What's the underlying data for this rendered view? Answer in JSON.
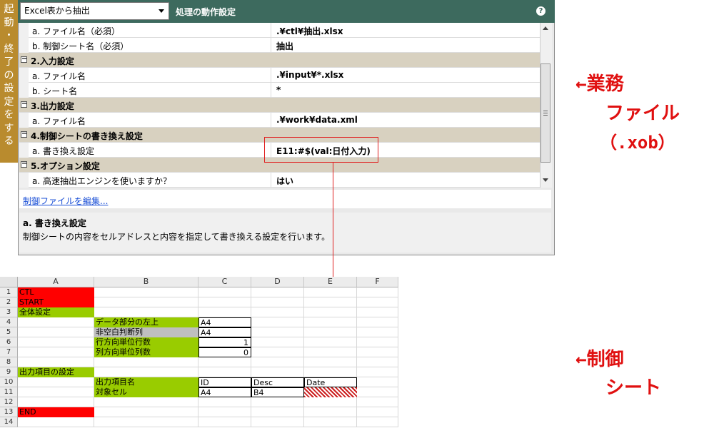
{
  "side_tab": {
    "chars": [
      "起",
      "動",
      "・",
      "終",
      "了",
      "の",
      "設",
      "定",
      "を",
      "す",
      "る"
    ]
  },
  "header": {
    "dropdown_value": "Excel表から抽出",
    "title": "処理の動作設定",
    "help": "?"
  },
  "rows": [
    {
      "type": "item",
      "label": "a. ファイル名（必須）",
      "value": ".¥ctl¥抽出.xlsx"
    },
    {
      "type": "item",
      "label": "b. 制御シート名（必須）",
      "value": "抽出"
    },
    {
      "type": "section",
      "label": "2.入力設定"
    },
    {
      "type": "item",
      "label": "a. ファイル名",
      "value": ".¥input¥*.xlsx"
    },
    {
      "type": "item",
      "label": "b. シート名",
      "value": "*"
    },
    {
      "type": "section",
      "label": "3.出力設定"
    },
    {
      "type": "item",
      "label": "a. ファイル名",
      "value": ".¥work¥data.xml"
    },
    {
      "type": "section",
      "label": "4.制御シートの書き換え設定"
    },
    {
      "type": "item",
      "label": "a. 書き換え設定",
      "value": "E11:#$(val:日付入力)"
    },
    {
      "type": "section",
      "label": "5.オプション設定"
    },
    {
      "type": "item",
      "label": "a. 高速抽出エンジンを使いますか？",
      "value": "はい"
    }
  ],
  "edit_link": "制御ファイルを編集...",
  "description": {
    "title": "a. 書き換え設定",
    "text": "制御シートの内容をセルアドレスと内容を指定して書き換える設定を行います。"
  },
  "annotations": {
    "business_file": [
      "←業務",
      "ファイル",
      "（.xob）"
    ],
    "control_sheet": [
      "←制御",
      "シート"
    ]
  },
  "spreadsheet": {
    "columns": [
      "A",
      "B",
      "C",
      "D",
      "E",
      "F"
    ],
    "rows": [
      "1",
      "2",
      "3",
      "4",
      "5",
      "6",
      "7",
      "8",
      "9",
      "10",
      "11",
      "12",
      "13",
      "14"
    ],
    "cells": {
      "A1": "CTL",
      "A2": "START",
      "A3": "全体設定",
      "B4": "データ部分の左上",
      "C4": "A4",
      "B5": "非空白判断列",
      "C5": "A4",
      "B6": "行方向単位行数",
      "C6": "1",
      "B7": "列方向単位列数",
      "C7": "0",
      "A9": "出力項目の設定",
      "B10": "出力項目名",
      "C10": "ID",
      "D10": "Desc",
      "E10": "Date",
      "B11": "対象セル",
      "C11": "A4",
      "D11": "B4",
      "A13": "END"
    }
  }
}
